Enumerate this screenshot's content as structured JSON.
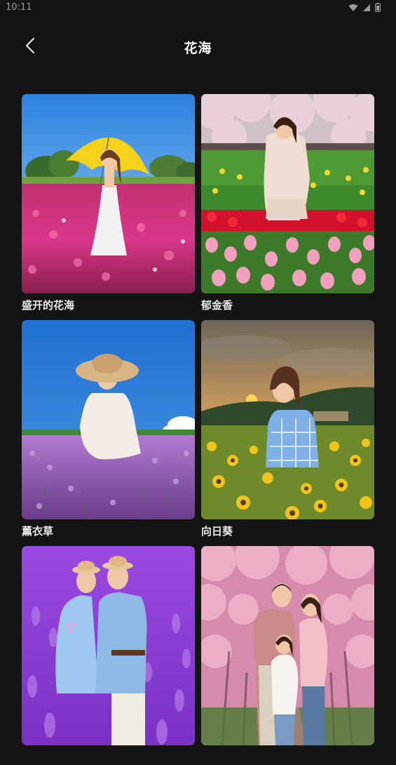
{
  "status_bar": {
    "time": "10:11",
    "icons": [
      "wifi-icon",
      "signal-icon",
      "battery-icon"
    ]
  },
  "header": {
    "back_icon": "chevron-left-icon",
    "title": "花海"
  },
  "templates": [
    {
      "label": "盛开的花海"
    },
    {
      "label": "郁金香"
    },
    {
      "label": "薰衣草"
    },
    {
      "label": "向日葵"
    },
    {
      "label": ""
    },
    {
      "label": ""
    }
  ],
  "colors": {
    "background": "#141414",
    "text": "#ffffff"
  }
}
